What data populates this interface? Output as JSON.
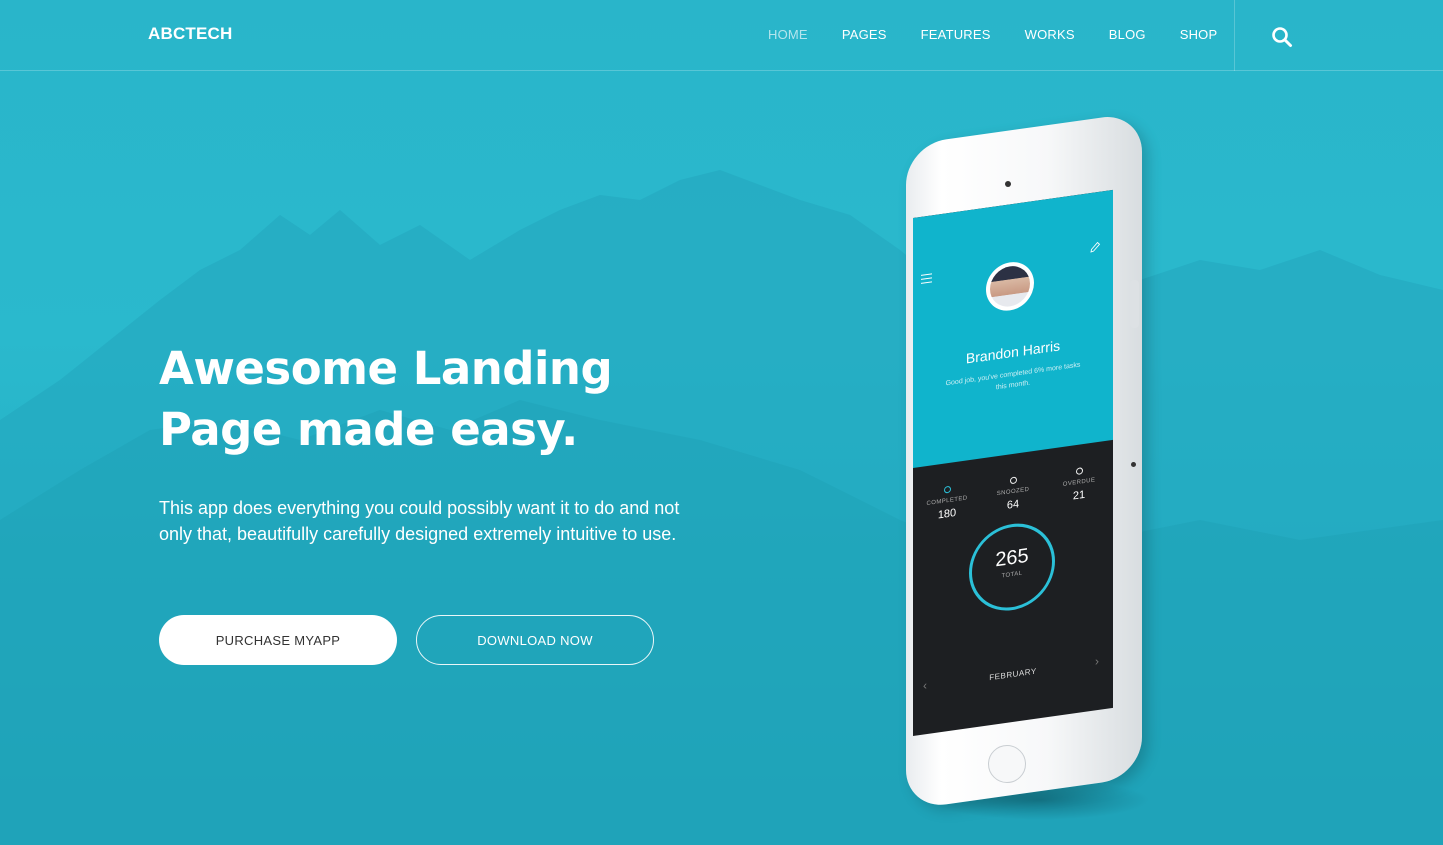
{
  "brand": {
    "logo": "ABCTECH",
    "accent": "#2ab3c8"
  },
  "nav": {
    "items": [
      {
        "label": "HOME",
        "active": true
      },
      {
        "label": "PAGES",
        "active": false
      },
      {
        "label": "FEATURES",
        "active": false
      },
      {
        "label": "WORKS",
        "active": false
      },
      {
        "label": "BLOG",
        "active": false
      },
      {
        "label": "SHOP",
        "active": false
      }
    ],
    "search_icon": "search-icon"
  },
  "hero": {
    "headline_line1": "Awesome Landing",
    "headline_line2": "Page made easy.",
    "subtext": "This app does everything you could possibly want it to do and not only that, beautifully carefully designed extremely intuitive to use.",
    "primary_button": "PURCHASE MYAPP",
    "secondary_button": "DOWNLOAD NOW"
  },
  "phone": {
    "profile_name": "Brandon Harris",
    "profile_sub": "Good job, you've completed 6% more tasks this month.",
    "stats": [
      {
        "label": "COMPLETED",
        "value": "180"
      },
      {
        "label": "SNOOZED",
        "value": "64"
      },
      {
        "label": "OVERDUE",
        "value": "21"
      }
    ],
    "total_value": "265",
    "total_label": "TOTAL",
    "month": "FEBRUARY",
    "prev": "‹",
    "next": "›"
  }
}
